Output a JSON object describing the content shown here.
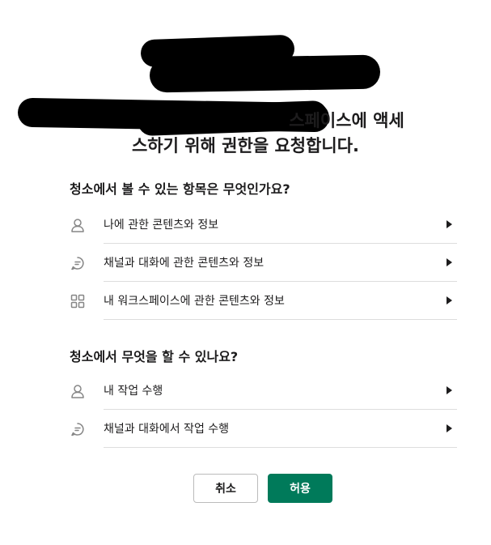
{
  "heading": {
    "line1": "스페이스에 액세",
    "line2": "스하기 위해 권한을 요청합니다."
  },
  "view_section": {
    "title": "청소에서 볼 수 있는 항목은 무엇인가요?",
    "items": [
      {
        "icon": "user-icon",
        "label": "나에 관한 콘텐츠와 정보"
      },
      {
        "icon": "chat-bubble-icon",
        "label": "채널과 대화에 관한 콘텐츠와 정보"
      },
      {
        "icon": "grid-icon",
        "label": "내 워크스페이스에 관한 콘텐츠와 정보"
      }
    ]
  },
  "do_section": {
    "title": "청소에서 무엇을 할 수 있나요?",
    "items": [
      {
        "icon": "user-icon",
        "label": "내 작업 수행"
      },
      {
        "icon": "chat-bubble-icon",
        "label": "채널과 대화에서 작업 수행"
      }
    ]
  },
  "buttons": {
    "cancel": "취소",
    "allow": "허용"
  },
  "colors": {
    "primary": "#007a5a",
    "text": "#1d1c1d",
    "divider": "#dddddd",
    "icon": "#868686"
  }
}
